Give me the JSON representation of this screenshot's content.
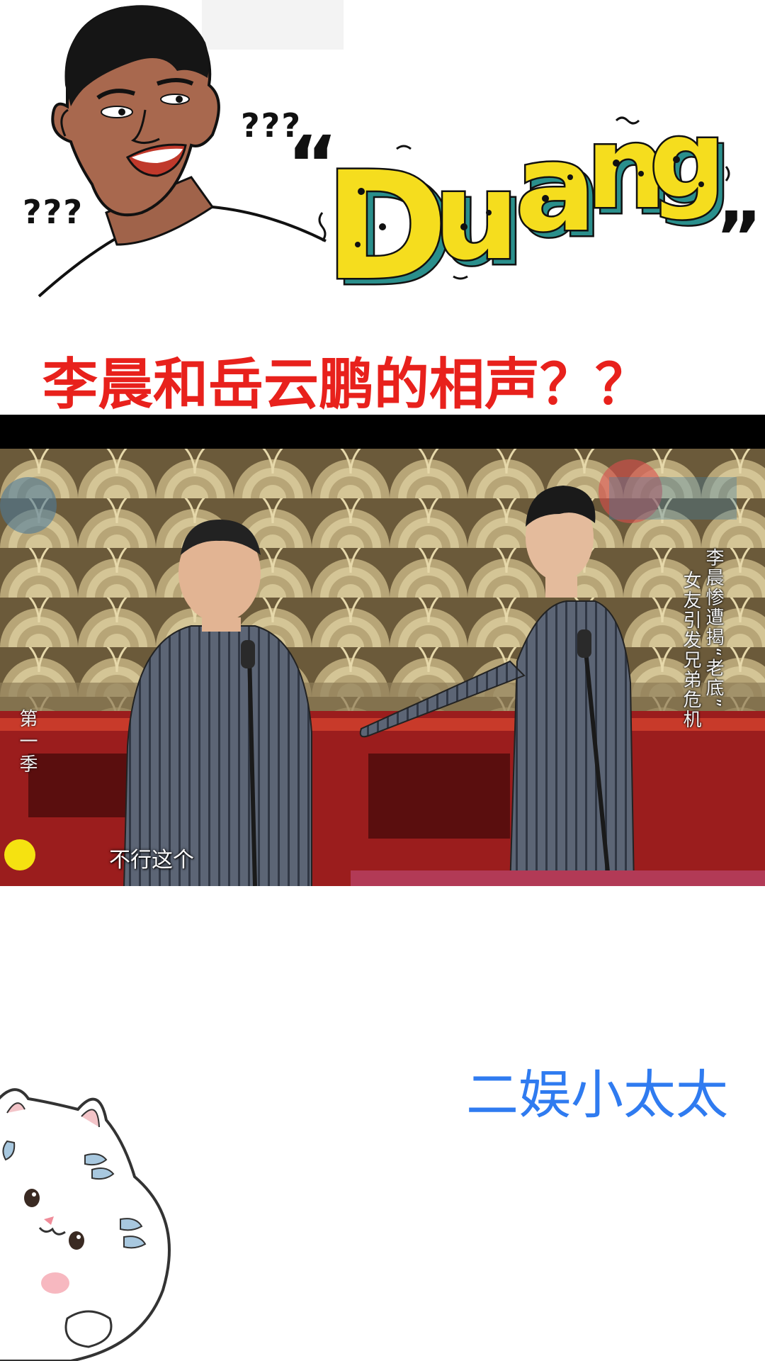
{
  "meme": {
    "question_marks_top": "???",
    "question_marks_left": "???",
    "duang_text": "Duang",
    "icon": "confused-man-meme"
  },
  "title": {
    "text": "李晨和岳云鹏的相声？？",
    "color": "#e8211c"
  },
  "video": {
    "side_caption_line1": "李晨惨遭揭“老底”",
    "side_caption_line2": "女友引发兄弟危机",
    "season_label": "第一季",
    "subtitle": "不行这个",
    "background_color": "#000000"
  },
  "watermark": {
    "text": "二娱小太太",
    "color": "#2f7bf0"
  },
  "sticker": {
    "icon": "white-cat-sticker"
  }
}
